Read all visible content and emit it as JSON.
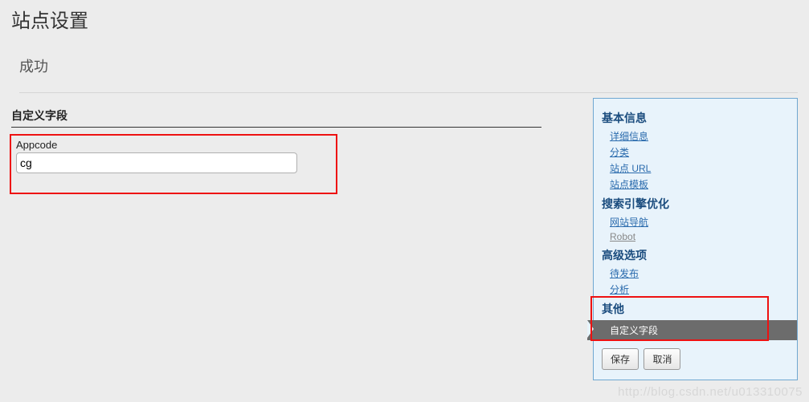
{
  "page": {
    "title": "站点设置",
    "success": "成功"
  },
  "main": {
    "section_heading": "自定义字段",
    "field": {
      "label": "Appcode",
      "value": "cg"
    }
  },
  "sidebar": {
    "groups": [
      {
        "title": "基本信息",
        "links": [
          "详细信息",
          "分类",
          "站点 URL",
          "站点模板"
        ]
      },
      {
        "title": "搜索引擎优化",
        "links": [
          "网站导航",
          "Robot"
        ]
      },
      {
        "title": "高级选项",
        "links": [
          "待发布",
          "分析"
        ]
      }
    ],
    "other": {
      "title": "其他",
      "active": "自定义字段"
    },
    "buttons": {
      "save": "保存",
      "cancel": "取消"
    }
  },
  "watermark": "http://blog.csdn.net/u013310075"
}
